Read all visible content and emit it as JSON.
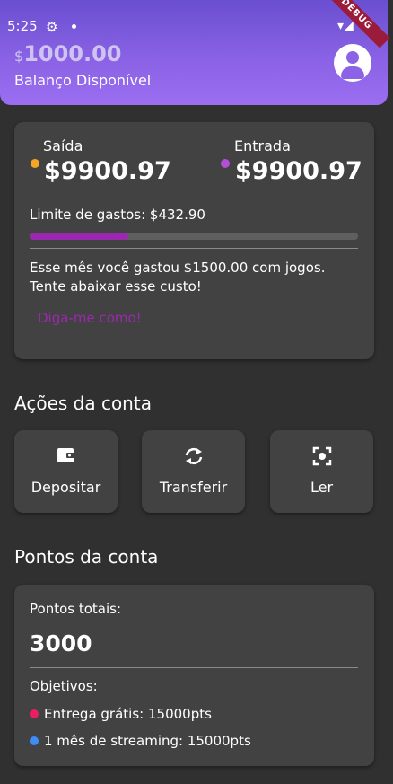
{
  "status_bar": {
    "time": "5:25",
    "debug_label": "DEBUG"
  },
  "header": {
    "currency": "$",
    "balance": "1000.00",
    "balance_label": "Balanço Disponível"
  },
  "summary": {
    "saida_label": "Saída",
    "saida_value": "$9900.97",
    "entrada_label": "Entrada",
    "entrada_value": "$9900.97",
    "limit_text": "Limite de gastos: $432.90",
    "progress_fraction": 0.3,
    "message": "Esse mês você gastou $1500.00 com jogos. Tente abaixar esse custo!",
    "link_label": "Diga-me como!"
  },
  "actions": {
    "title": "Ações da conta",
    "items": [
      {
        "label": "Depositar",
        "icon": "wallet-icon"
      },
      {
        "label": "Transferir",
        "icon": "sync-icon"
      },
      {
        "label": "Ler",
        "icon": "scan-icon"
      }
    ]
  },
  "points": {
    "title": "Pontos da conta",
    "total_label": "Pontos totais:",
    "total_value": "3000",
    "goals_label": "Objetivos:",
    "goals": [
      {
        "text": "Entrega grátis: 15000pts",
        "color": "#e91e63"
      },
      {
        "text": "1 mês de streaming: 15000pts",
        "color": "#3f8cf7"
      }
    ]
  },
  "colors": {
    "accent": "#9c27b0",
    "header_start": "#6a4fd0",
    "header_end": "#9b6ef0",
    "saida_dot": "#f5a623",
    "entrada_dot": "#b24fd6",
    "background": "#303030",
    "card": "#424242"
  }
}
